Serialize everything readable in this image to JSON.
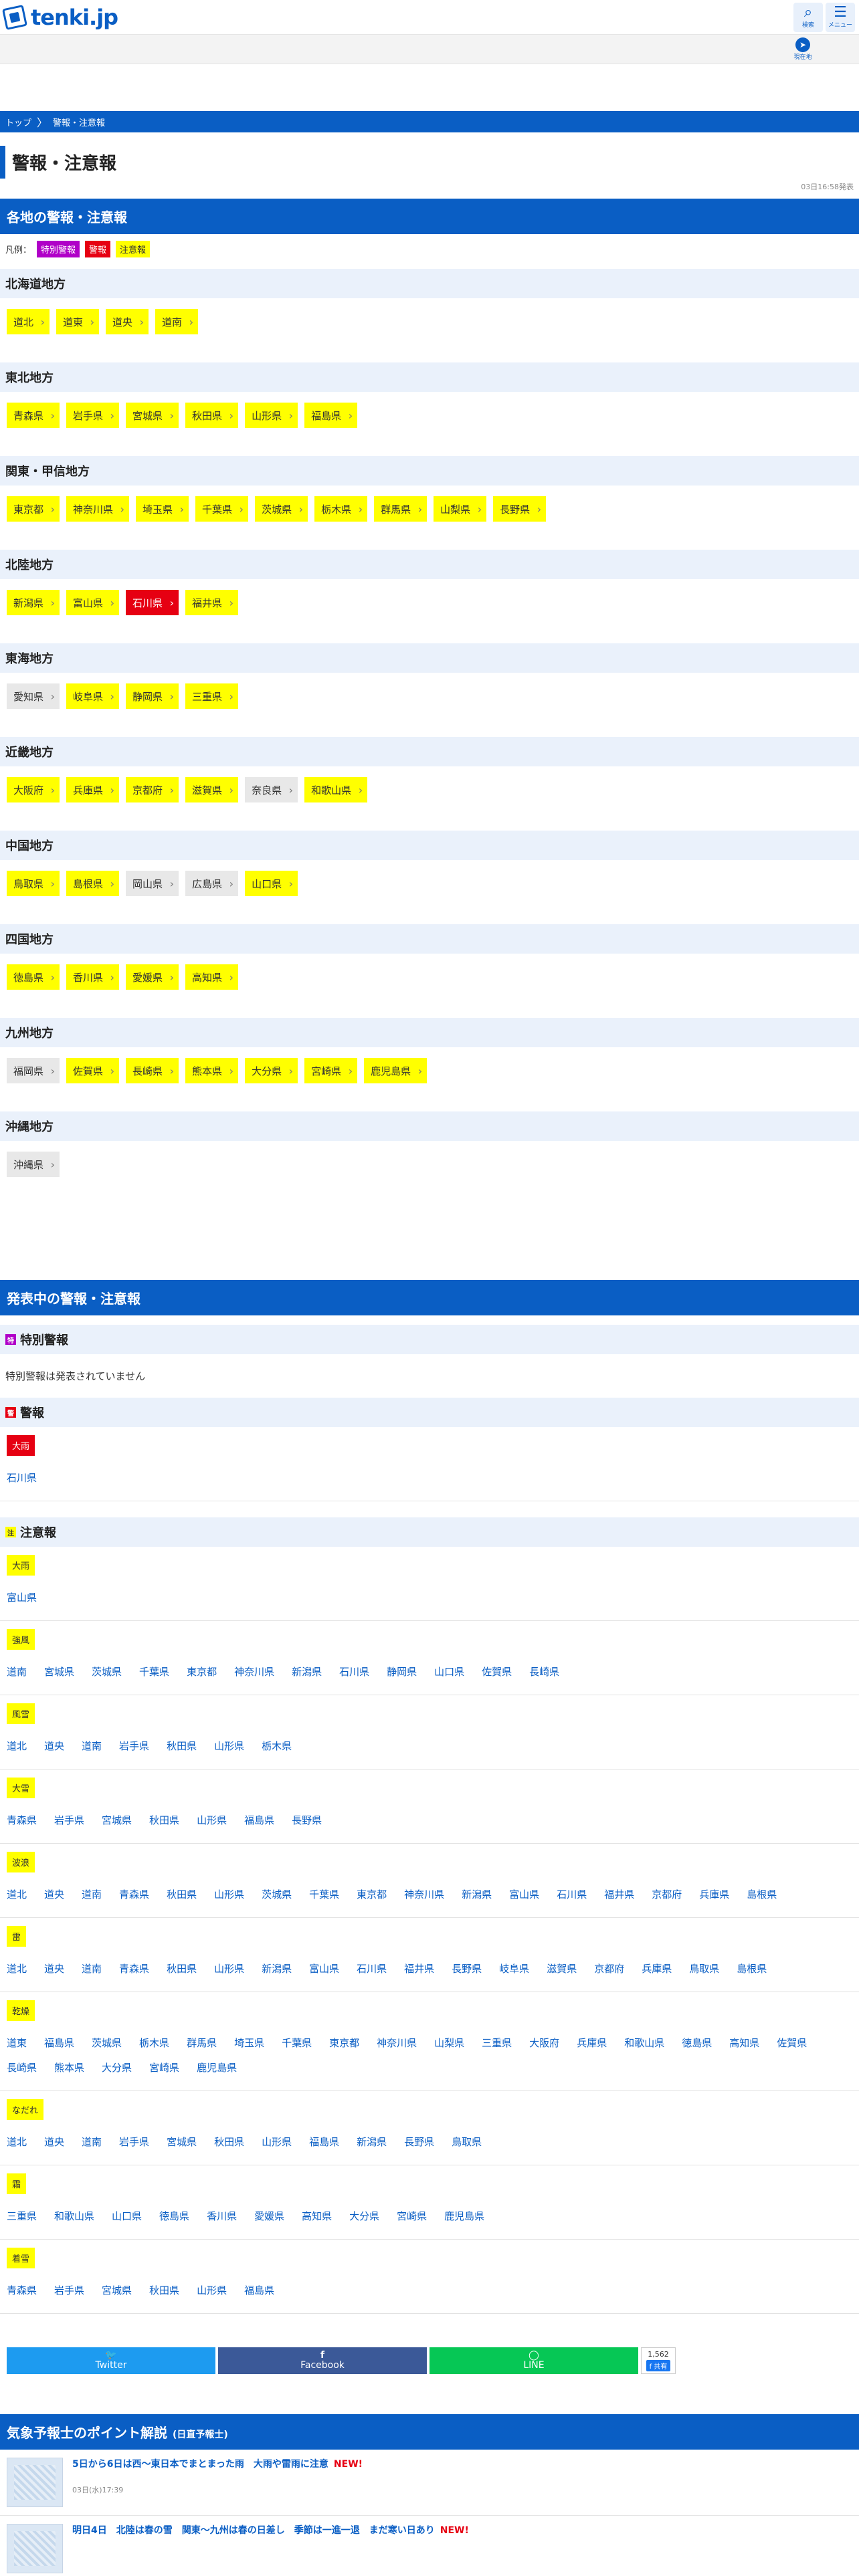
{
  "header": {
    "logo": "tenki.jp",
    "search_label": "検索",
    "menu_label": "メニュー",
    "location_label": "現在地"
  },
  "breadcrumb": {
    "top": "トップ",
    "current": "警報・注意報"
  },
  "page": {
    "title": "警報・注意報",
    "updated": "03日16:58発表"
  },
  "regional": {
    "heading": "各地の警報・注意報",
    "legend_label": "凡例：",
    "legend": [
      {
        "label": "特別警報",
        "level": "sp"
      },
      {
        "label": "警報",
        "level": "w"
      },
      {
        "label": "注意報",
        "level": "a"
      }
    ],
    "regions": [
      {
        "name": "北海道地方",
        "prefs": [
          {
            "n": "道北",
            "l": "a"
          },
          {
            "n": "道東",
            "l": "a"
          },
          {
            "n": "道央",
            "l": "a"
          },
          {
            "n": "道南",
            "l": "a"
          }
        ]
      },
      {
        "name": "東北地方",
        "prefs": [
          {
            "n": "青森県",
            "l": "a"
          },
          {
            "n": "岩手県",
            "l": "a"
          },
          {
            "n": "宮城県",
            "l": "a"
          },
          {
            "n": "秋田県",
            "l": "a"
          },
          {
            "n": "山形県",
            "l": "a"
          },
          {
            "n": "福島県",
            "l": "a"
          }
        ]
      },
      {
        "name": "関東・甲信地方",
        "prefs": [
          {
            "n": "東京都",
            "l": "a"
          },
          {
            "n": "神奈川県",
            "l": "a"
          },
          {
            "n": "埼玉県",
            "l": "a"
          },
          {
            "n": "千葉県",
            "l": "a"
          },
          {
            "n": "茨城県",
            "l": "a"
          },
          {
            "n": "栃木県",
            "l": "a"
          },
          {
            "n": "群馬県",
            "l": "a"
          },
          {
            "n": "山梨県",
            "l": "a"
          },
          {
            "n": "長野県",
            "l": "a"
          }
        ]
      },
      {
        "name": "北陸地方",
        "prefs": [
          {
            "n": "新潟県",
            "l": "a"
          },
          {
            "n": "富山県",
            "l": "a"
          },
          {
            "n": "石川県",
            "l": "w"
          },
          {
            "n": "福井県",
            "l": "a"
          }
        ]
      },
      {
        "name": "東海地方",
        "prefs": [
          {
            "n": "愛知県",
            "l": "n"
          },
          {
            "n": "岐阜県",
            "l": "a"
          },
          {
            "n": "静岡県",
            "l": "a"
          },
          {
            "n": "三重県",
            "l": "a"
          }
        ]
      },
      {
        "name": "近畿地方",
        "prefs": [
          {
            "n": "大阪府",
            "l": "a"
          },
          {
            "n": "兵庫県",
            "l": "a"
          },
          {
            "n": "京都府",
            "l": "a"
          },
          {
            "n": "滋賀県",
            "l": "a"
          },
          {
            "n": "奈良県",
            "l": "n"
          },
          {
            "n": "和歌山県",
            "l": "a"
          }
        ]
      },
      {
        "name": "中国地方",
        "prefs": [
          {
            "n": "鳥取県",
            "l": "a"
          },
          {
            "n": "島根県",
            "l": "a"
          },
          {
            "n": "岡山県",
            "l": "n"
          },
          {
            "n": "広島県",
            "l": "n"
          },
          {
            "n": "山口県",
            "l": "a"
          }
        ]
      },
      {
        "name": "四国地方",
        "prefs": [
          {
            "n": "徳島県",
            "l": "a"
          },
          {
            "n": "香川県",
            "l": "a"
          },
          {
            "n": "愛媛県",
            "l": "a"
          },
          {
            "n": "高知県",
            "l": "a"
          }
        ]
      },
      {
        "name": "九州地方",
        "prefs": [
          {
            "n": "福岡県",
            "l": "n"
          },
          {
            "n": "佐賀県",
            "l": "a"
          },
          {
            "n": "長崎県",
            "l": "a"
          },
          {
            "n": "熊本県",
            "l": "a"
          },
          {
            "n": "大分県",
            "l": "a"
          },
          {
            "n": "宮崎県",
            "l": "a"
          },
          {
            "n": "鹿児島県",
            "l": "a"
          }
        ]
      },
      {
        "name": "沖縄地方",
        "prefs": [
          {
            "n": "沖縄県",
            "l": "n"
          }
        ]
      }
    ]
  },
  "issued": {
    "heading": "発表中の警報・注意報",
    "special": {
      "title": "特別警報",
      "icon": "特",
      "none_text": "特別警報は発表されていません"
    },
    "warnings": {
      "title": "警報",
      "icon": "警",
      "types": [
        {
          "label": "大雨",
          "prefs": [
            "石川県"
          ]
        }
      ]
    },
    "advisories": {
      "title": "注意報",
      "icon": "注",
      "types": [
        {
          "label": "大雨",
          "prefs": [
            "富山県"
          ]
        },
        {
          "label": "強風",
          "prefs": [
            "道南",
            "宮城県",
            "茨城県",
            "千葉県",
            "東京都",
            "神奈川県",
            "新潟県",
            "石川県",
            "静岡県",
            "山口県",
            "佐賀県",
            "長崎県"
          ]
        },
        {
          "label": "風雪",
          "prefs": [
            "道北",
            "道央",
            "道南",
            "岩手県",
            "秋田県",
            "山形県",
            "栃木県"
          ]
        },
        {
          "label": "大雪",
          "prefs": [
            "青森県",
            "岩手県",
            "宮城県",
            "秋田県",
            "山形県",
            "福島県",
            "長野県"
          ]
        },
        {
          "label": "波浪",
          "prefs": [
            "道北",
            "道央",
            "道南",
            "青森県",
            "秋田県",
            "山形県",
            "茨城県",
            "千葉県",
            "東京都",
            "神奈川県",
            "新潟県",
            "富山県",
            "石川県",
            "福井県",
            "京都府",
            "兵庫県",
            "島根県"
          ]
        },
        {
          "label": "雷",
          "prefs": [
            "道北",
            "道央",
            "道南",
            "青森県",
            "秋田県",
            "山形県",
            "新潟県",
            "富山県",
            "石川県",
            "福井県",
            "長野県",
            "岐阜県",
            "滋賀県",
            "京都府",
            "兵庫県",
            "鳥取県",
            "島根県"
          ]
        },
        {
          "label": "乾燥",
          "prefs": [
            "道東",
            "福島県",
            "茨城県",
            "栃木県",
            "群馬県",
            "埼玉県",
            "千葉県",
            "東京都",
            "神奈川県",
            "山梨県",
            "三重県",
            "大阪府",
            "兵庫県",
            "和歌山県",
            "徳島県",
            "高知県",
            "佐賀県",
            "長崎県",
            "熊本県",
            "大分県",
            "宮崎県",
            "鹿児島県"
          ]
        },
        {
          "label": "なだれ",
          "prefs": [
            "道北",
            "道央",
            "道南",
            "岩手県",
            "宮城県",
            "秋田県",
            "山形県",
            "福島県",
            "新潟県",
            "長野県",
            "鳥取県"
          ]
        },
        {
          "label": "霜",
          "prefs": [
            "三重県",
            "和歌山県",
            "山口県",
            "徳島県",
            "香川県",
            "愛媛県",
            "高知県",
            "大分県",
            "宮崎県",
            "鹿児島県"
          ]
        },
        {
          "label": "着雪",
          "prefs": [
            "青森県",
            "岩手県",
            "宮城県",
            "秋田県",
            "山形県",
            "福島県"
          ]
        }
      ]
    }
  },
  "share": {
    "twitter": "Twitter",
    "facebook": "Facebook",
    "line": "LINE",
    "count": "1,562",
    "count_fb": "f 共有"
  },
  "points": {
    "heading": "気象予報士のポイント解説",
    "sub": "(日直予報士)",
    "items": [
      {
        "title": "5日から6日は西〜東日本でまとまった雨　大雨や雷雨に注意",
        "new": "NEW!",
        "date": "03日(水)17:39"
      },
      {
        "title": "明日4日　北陸は春の雪　関東〜九州は春の日差し　季節は一進一退　まだ寒い日あり",
        "new": "NEW!",
        "date": ""
      }
    ]
  }
}
